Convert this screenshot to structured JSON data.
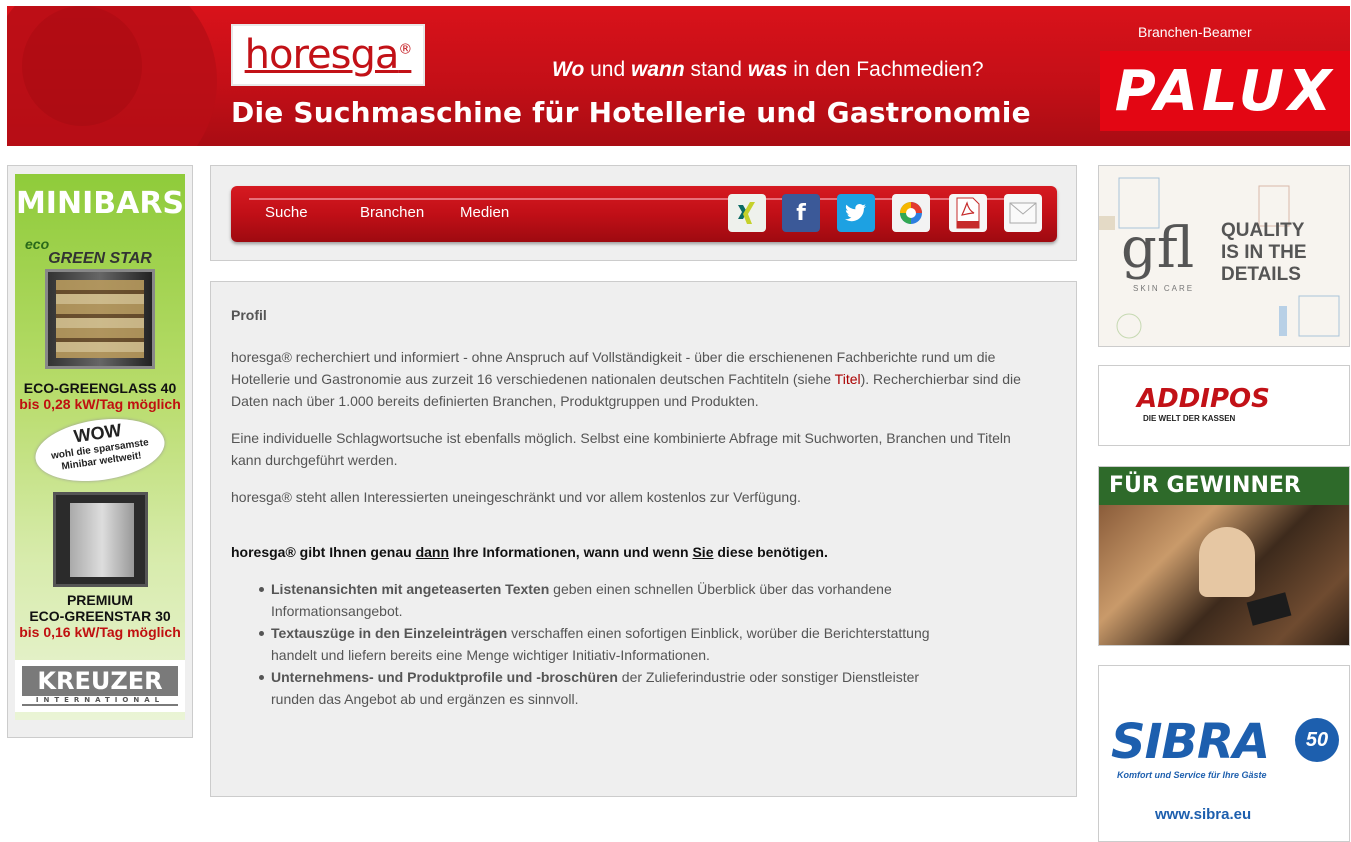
{
  "header": {
    "logo": "horesga",
    "logo_mark": "®",
    "tagline_wo": "Wo",
    "tagline_und": " und ",
    "tagline_wann": "wann",
    "tagline_stand": " stand ",
    "tagline_was": "was",
    "tagline_rest": " in den Fachmedien?",
    "headline": "Die Suchmaschine für Hotellerie und Gastronomie",
    "sponsor_label": "Branchen-Beamer",
    "sponsor_logo": "PALUX",
    "brand_color": "#c40f17"
  },
  "nav": {
    "links": [
      "Suche",
      "Branchen",
      "Medien"
    ],
    "share_icons": [
      "xing-icon",
      "facebook-icon",
      "twitter-icon",
      "google-buzz-icon",
      "pdf-icon",
      "email-icon"
    ],
    "pdf_label": "PDF"
  },
  "left_ad": {
    "title": "MINIBARS",
    "eco": "eco",
    "greenstar": "GREEN STAR",
    "model1": "ECO-GREENGLASS 40",
    "power1": "bis 0,28 kW/Tag möglich",
    "wow": "WOW",
    "wow_sub1": "wohl die sparsamste",
    "wow_sub2": "Minibar weltweit!",
    "premium": "PREMIUM",
    "model2": "ECO-GREENSTAR 30",
    "power2": "bis 0,16 kW/Tag möglich",
    "brand": "KREUZER",
    "brand_sub": "INTERNATIONAL"
  },
  "content": {
    "heading": "Profil",
    "p1_before": "horesga® recherchiert und informiert - ohne Anspruch auf Vollständigkeit - über die erschienenen Fachberichte rund um die Hotellerie und Gastronomie aus zurzeit 16 verschiedenen nationalen deutschen Fachtiteln (siehe ",
    "p1_link": "Titel",
    "p1_after": "). Recherchierbar sind die Daten nach über 1.000 bereits definierten Branchen, Produktgruppen und Produkten.",
    "p2": "Eine individuelle Schlagwortsuche ist ebenfalls möglich. Selbst eine kombinierte Abfrage mit Suchworten, Branchen und Titeln kann durchgeführt werden.",
    "p3": "horesga® steht allen Interessierten uneingeschränkt und vor allem kostenlos zur Verfügung.",
    "lead_a": "horesga® gibt Ihnen genau ",
    "lead_dann": "dann",
    "lead_b": " Ihre Informationen, wann und wenn ",
    "lead_sie": "Sie",
    "lead_c": " diese benötigen.",
    "bullets": [
      {
        "bold": "Listenansichten mit angeteaserten Texten",
        "text": " geben einen schnellen Überblick über das vorhandene Informationsangebot."
      },
      {
        "bold": "Textauszüge in den Einzeleinträgen",
        "text": " verschaffen einen sofortigen Einblick, worüber die Berichterstattung handelt und liefern bereits eine Menge wichtiger Initiativ-Informationen."
      },
      {
        "bold": "Unternehmens- und Produktprofile und -broschüren",
        "text": " der Zulieferindustrie oder sonstiger Dienstleister runden das Angebot ab und ergänzen es sinnvoll."
      }
    ]
  },
  "right_ads": {
    "gfl_logo": "gfl",
    "gfl_sub": "SKIN CARE",
    "gfl_slogan": [
      "QUALITY",
      "IS IN THE",
      "DETAILS"
    ],
    "addipos": "ADDIPOS",
    "addipos_sub": "DIE WELT DER KASSEN",
    "gewinner": "FÜR GEWINNER",
    "sibra": "SIBRA",
    "sibra_50": "50",
    "sibra_sub": "Komfort und Service für Ihre Gäste",
    "sibra_url": "www.sibra.eu"
  }
}
